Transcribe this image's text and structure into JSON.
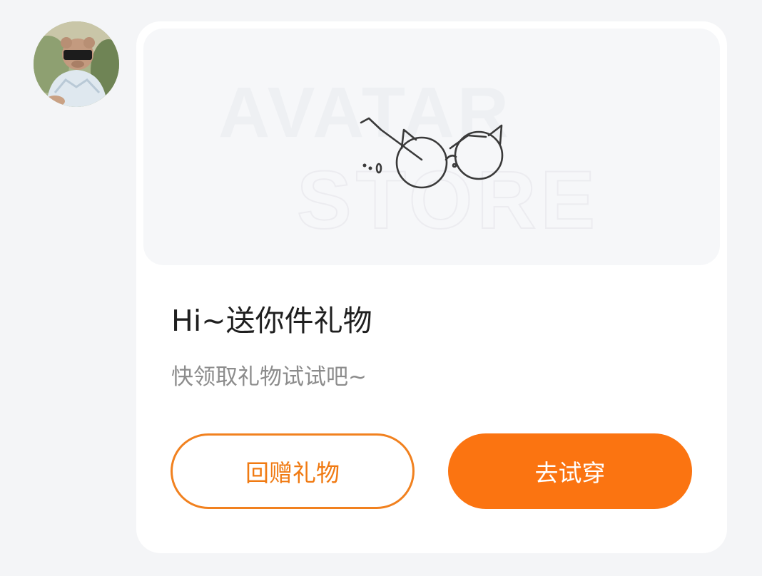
{
  "avatar": {
    "icon": "user-avatar-photo"
  },
  "banner": {
    "watermark_line1": "AVATAR",
    "watermark_line2": "STORE",
    "item_icon": "cat-ear-glasses-icon"
  },
  "message": {
    "title": "Hi~送你件礼物",
    "subtitle": "快领取礼物试试吧~"
  },
  "buttons": {
    "return_gift_label": "回赠礼物",
    "try_on_label": "去试穿"
  },
  "colors": {
    "accent": "#fb7411",
    "outline": "#f1811f",
    "background": "#f4f5f7",
    "card": "#ffffff"
  }
}
